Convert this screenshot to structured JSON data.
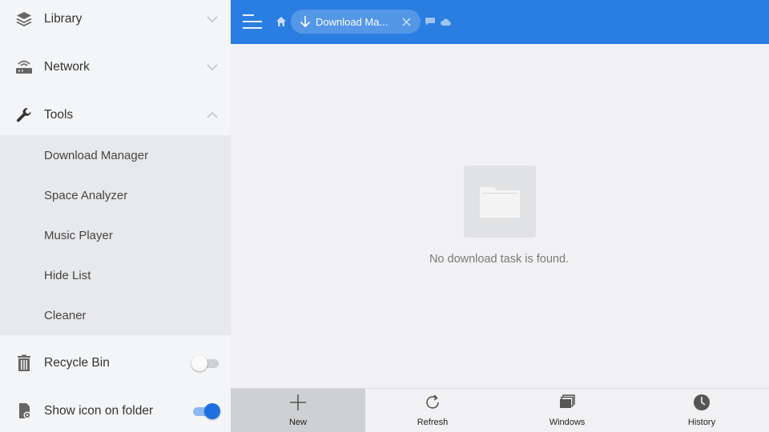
{
  "sidebar": {
    "sections": [
      {
        "label": "Library",
        "icon": "layers-icon",
        "expanded": false
      },
      {
        "label": "Network",
        "icon": "router-icon",
        "expanded": false
      },
      {
        "label": "Tools",
        "icon": "wrench-icon",
        "expanded": true
      }
    ],
    "tools_items": [
      "Download Manager",
      "Space Analyzer",
      "Music Player",
      "Hide List",
      "Cleaner"
    ],
    "recycle_bin": {
      "label": "Recycle Bin",
      "enabled": false
    },
    "show_icon": {
      "label": "Show icon on folder",
      "enabled": true
    }
  },
  "header": {
    "tab_label": "Download Ma...",
    "accent": "#2a7de1"
  },
  "main": {
    "empty_message": "No download task is found."
  },
  "bottombar": {
    "items": [
      {
        "label": "New",
        "icon": "plus-icon",
        "active": true
      },
      {
        "label": "Refresh",
        "icon": "refresh-icon",
        "active": false
      },
      {
        "label": "Windows",
        "icon": "windows-icon",
        "active": false
      },
      {
        "label": "History",
        "icon": "clock-icon",
        "active": false
      }
    ]
  }
}
